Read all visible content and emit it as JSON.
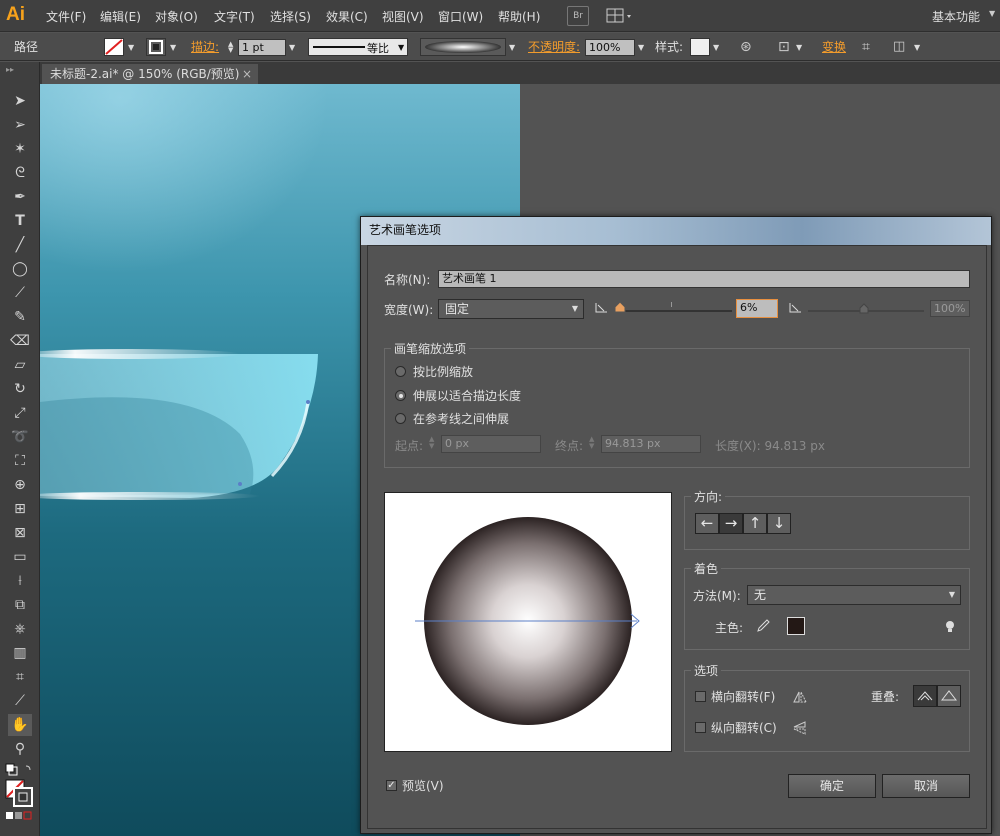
{
  "app": {
    "logo": "Ai",
    "menu": [
      "文件(F)",
      "编辑(E)",
      "对象(O)",
      "文字(T)",
      "选择(S)",
      "效果(C)",
      "视图(V)",
      "窗口(W)",
      "帮助(H)"
    ],
    "bridge_label": "Br",
    "workspace": "基本功能"
  },
  "controlbar": {
    "selection_type": "路径",
    "stroke_label": "描边:",
    "stroke_weight": "1 pt",
    "profile_label": "等比",
    "opacity_label": "不透明度:",
    "opacity_value": "100%",
    "style_label": "样式:",
    "transform_label": "变换"
  },
  "document": {
    "tab_title": "未标题-2.ai* @ 150% (RGB/预览)",
    "tab_close": "×"
  },
  "dialog": {
    "title": "艺术画笔选项",
    "name_label": "名称(N):",
    "name_value": "艺术画笔 1",
    "width_label": "宽度(W):",
    "width_option": "固定",
    "width_value": "6%",
    "width_max": "100%",
    "scale_group": "画笔缩放选项",
    "scale_options": [
      "按比例缩放",
      "伸展以适合描边长度",
      "在参考线之间伸展"
    ],
    "scale_selected": 1,
    "start_label": "起点:",
    "start_value": "0 px",
    "end_label": "终点:",
    "end_value": "94.813 px",
    "length_text": "长度(X): 94.813 px",
    "direction_label": "方向:",
    "direction_buttons": [
      "←",
      "→",
      "↑",
      "↓"
    ],
    "direction_selected": 1,
    "color_group": "着色",
    "method_label": "方法(M):",
    "method_value": "无",
    "keycolor_label": "主色:",
    "options_group": "选项",
    "flip_h": "横向翻转(F)",
    "flip_v": "纵向翻转(C)",
    "overlap_label": "重叠:",
    "preview_label": "预览(V)",
    "preview_checked": true,
    "ok_label": "确定",
    "cancel_label": "取消",
    "accent_blue": "#5b7fc7"
  }
}
